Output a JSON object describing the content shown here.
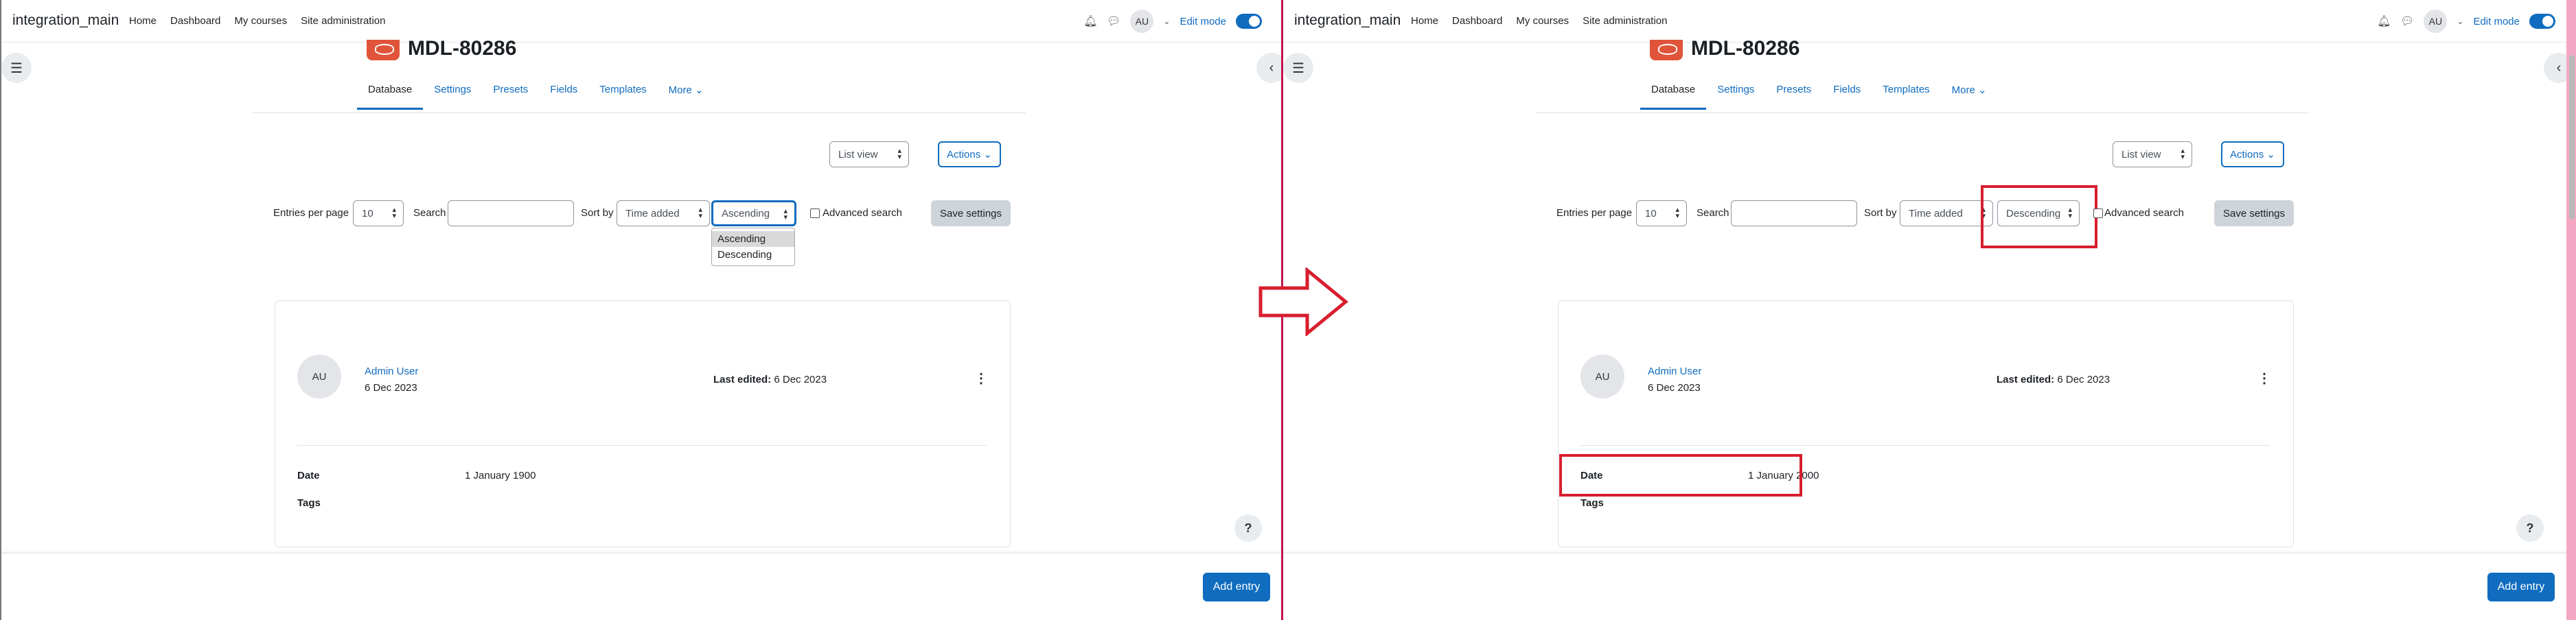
{
  "left": {
    "site_name": "integration_main",
    "nav": [
      "Home",
      "Dashboard",
      "My courses",
      "Site administration"
    ],
    "user_initials": "AU",
    "edit_mode_label": "Edit mode",
    "page_title": "MDL-80286",
    "tabs": [
      "Database",
      "Settings",
      "Presets",
      "Fields",
      "Templates",
      "More"
    ],
    "view_select": "List view",
    "actions_label": "Actions",
    "entries_label": "Entries per page",
    "entries_value": "10",
    "search_label": "Search",
    "sort_label": "Sort by",
    "sort_field": "Time added",
    "order_value": "Ascending",
    "order_options": [
      "Ascending",
      "Descending"
    ],
    "advanced_search_label": "Advanced search",
    "save_settings_label": "Save settings",
    "entry": {
      "avatar": "AU",
      "author": "Admin User",
      "date": "6 Dec 2023",
      "last_edited_label": "Last edited:",
      "last_edited_value": "6 Dec 2023",
      "field_date_label": "Date",
      "field_date_value": "1 January 1900",
      "field_tags_label": "Tags"
    },
    "help_label": "?",
    "add_entry_label": "Add entry"
  },
  "right": {
    "site_name": "integration_main",
    "nav": [
      "Home",
      "Dashboard",
      "My courses",
      "Site administration"
    ],
    "user_initials": "AU",
    "edit_mode_label": "Edit mode",
    "page_title": "MDL-80286",
    "tabs": [
      "Database",
      "Settings",
      "Presets",
      "Fields",
      "Templates",
      "More"
    ],
    "view_select": "List view",
    "actions_label": "Actions",
    "entries_label": "Entries per page",
    "entries_value": "10",
    "search_label": "Search",
    "sort_label": "Sort by",
    "sort_field": "Time added",
    "order_value": "Descending",
    "advanced_search_label": "Advanced search",
    "save_settings_label": "Save settings",
    "entry": {
      "avatar": "AU",
      "author": "Admin User",
      "date": "6 Dec 2023",
      "last_edited_label": "Last edited:",
      "last_edited_value": "6 Dec 2023",
      "field_date_label": "Date",
      "field_date_value": "1 January 2000",
      "field_tags_label": "Tags"
    },
    "help_label": "?",
    "add_entry_label": "Add entry"
  },
  "colors": {
    "accent": "#0f6cbf",
    "annotation_red": "#d81e2e",
    "divider": "#c0174f",
    "db_icon": "#e0543a"
  },
  "icons": [
    "bell-icon",
    "chat-icon",
    "drawer-index-icon",
    "chevron-left-icon",
    "kebab-menu-icon",
    "help-icon",
    "database-icon"
  ]
}
